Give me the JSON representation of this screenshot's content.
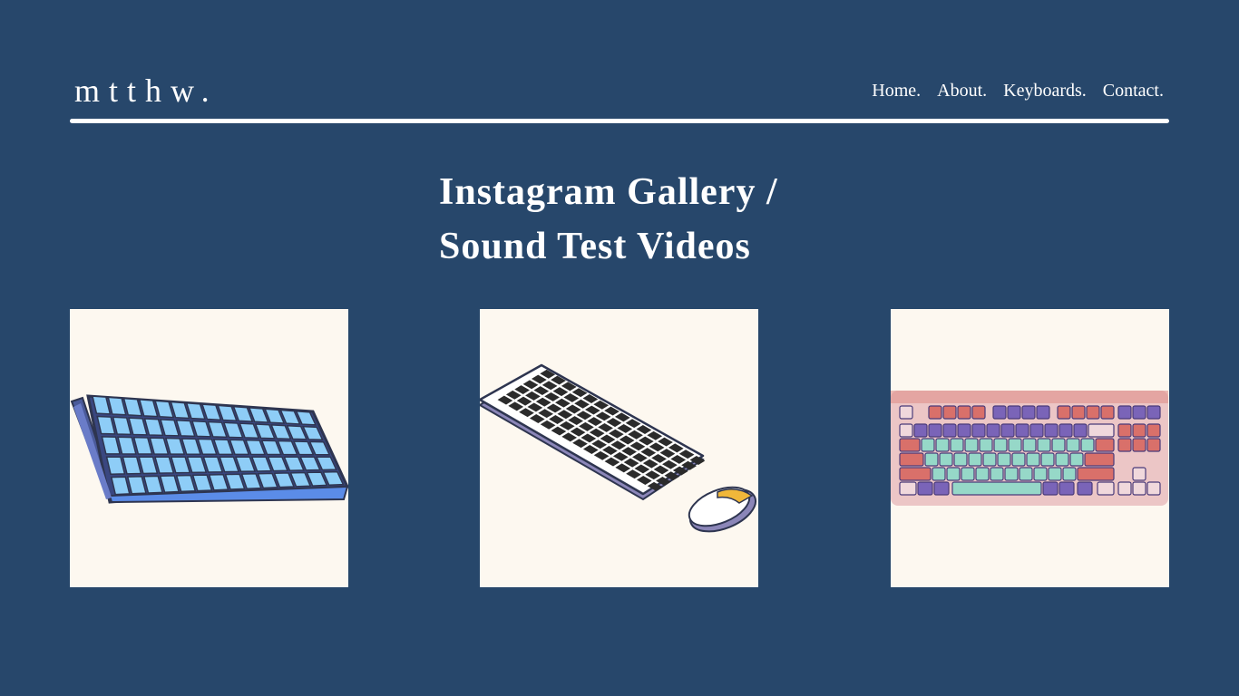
{
  "header": {
    "brand": "mtthw.",
    "nav": [
      {
        "label": "Home."
      },
      {
        "label": "About."
      },
      {
        "label": "Keyboards."
      },
      {
        "label": "Contact."
      }
    ]
  },
  "main": {
    "title_line1": "Instagram Gallery /",
    "title_line2": "Sound Test Videos"
  },
  "gallery": {
    "items": [
      {
        "icon": "blue-mechanical-keyboard-icon"
      },
      {
        "icon": "black-keyboard-and-mouse-icon"
      },
      {
        "icon": "pastel-keyboard-icon"
      }
    ]
  },
  "colors": {
    "background": "#27476b",
    "card": "#fdf8f0",
    "text": "#ffffff"
  }
}
